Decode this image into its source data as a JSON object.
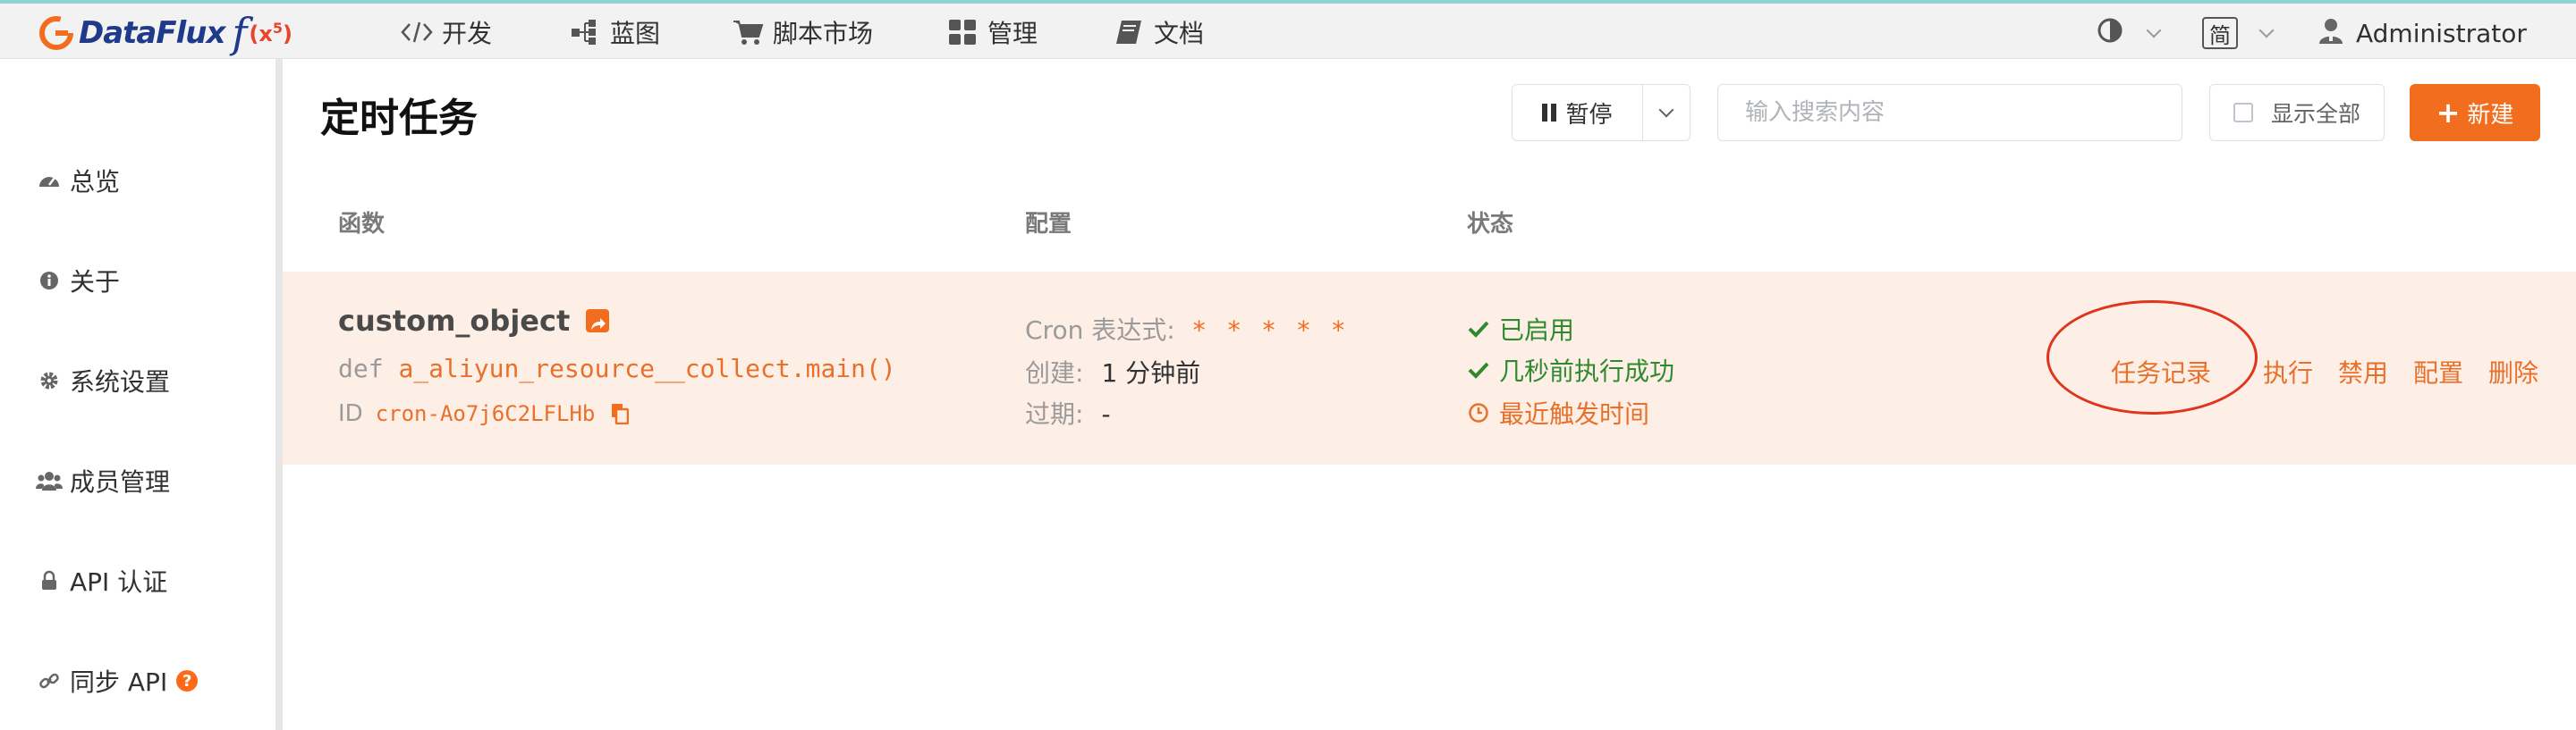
{
  "header": {
    "logo_text": "DataFlux",
    "logo_f": "f",
    "logo_x": "(x",
    "logo_sup": "5",
    "logo_close": ")",
    "nav": [
      {
        "label": "开发",
        "icon": "code-icon"
      },
      {
        "label": "蓝图",
        "icon": "blueprint-icon"
      },
      {
        "label": "脚本市场",
        "icon": "cart-icon"
      },
      {
        "label": "管理",
        "icon": "grid-icon"
      },
      {
        "label": "文档",
        "icon": "book-icon"
      }
    ],
    "lang": "简",
    "user": "Administrator"
  },
  "sidebar": {
    "items": [
      {
        "label": "总览",
        "icon": "dashboard-icon"
      },
      {
        "label": "关于",
        "icon": "info-icon"
      },
      {
        "label": "系统设置",
        "icon": "gear-icon"
      },
      {
        "label": "成员管理",
        "icon": "users-icon"
      },
      {
        "label": "API 认证",
        "icon": "lock-icon"
      },
      {
        "label": "同步 API",
        "icon": "link-icon",
        "badge": "?"
      }
    ]
  },
  "main": {
    "title": "定时任务",
    "pause_label": "暂停",
    "search_placeholder": "输入搜索内容",
    "show_all_label": "显示全部",
    "new_label": "新建",
    "columns": [
      "函数",
      "配置",
      "状态"
    ],
    "row": {
      "name": "custom_object",
      "def_prefix": "def",
      "def_code": "a_aliyun_resource__collect.main()",
      "id_prefix": "ID",
      "id_code": "cron-Ao7j6C2LFLHb",
      "cron_label": "Cron 表达式:",
      "cron_value": "* * * * *",
      "created_label": "创建:",
      "created_value": "1 分钟前",
      "expire_label": "过期:",
      "expire_value": "-",
      "status_enabled": "已启用",
      "status_success": "几秒前执行成功",
      "status_trigger": "最近触发时间",
      "actions": [
        "任务记录",
        "执行",
        "禁用",
        "配置",
        "删除"
      ]
    }
  },
  "colors": {
    "accent": "#f26d1d",
    "row_bg": "#fdefe6",
    "success": "#2f8a2f",
    "annotation": "#e0341d"
  }
}
